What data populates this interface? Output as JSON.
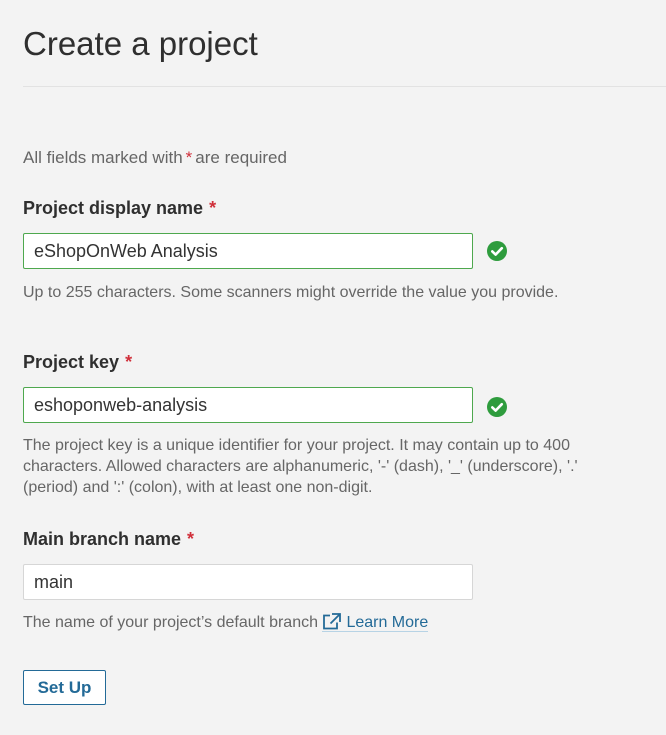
{
  "page": {
    "title": "Create a project"
  },
  "required_note": {
    "prefix": "All fields marked with",
    "star": "*",
    "suffix": "are required"
  },
  "fields": {
    "display_name": {
      "label": "Project display name",
      "required_mark": "*",
      "value": "eShopOnWeb Analysis",
      "valid": true,
      "icon": "check-circle-icon",
      "help": "Up to 255 characters. Some scanners might override the value you provide."
    },
    "project_key": {
      "label": "Project key",
      "required_mark": "*",
      "value": "eshoponweb-analysis",
      "valid": true,
      "icon": "check-circle-icon",
      "help": "The project key is a unique identifier for your project. It may contain up to 400 characters. Allowed characters are alphanumeric, '-' (dash), '_' (underscore), '.' (period) and ':' (colon), with at least one non-digit."
    },
    "main_branch": {
      "label": "Main branch name",
      "required_mark": "*",
      "value": "main",
      "help": "The name of your project’s default branch",
      "link_label": "Learn More",
      "link_icon": "external-link-icon"
    }
  },
  "actions": {
    "setup_label": "Set Up"
  },
  "colors": {
    "required": "#d02f3a",
    "valid_border": "#4ea84e",
    "valid_icon": "#2e9c3d",
    "link": "#236a97"
  }
}
